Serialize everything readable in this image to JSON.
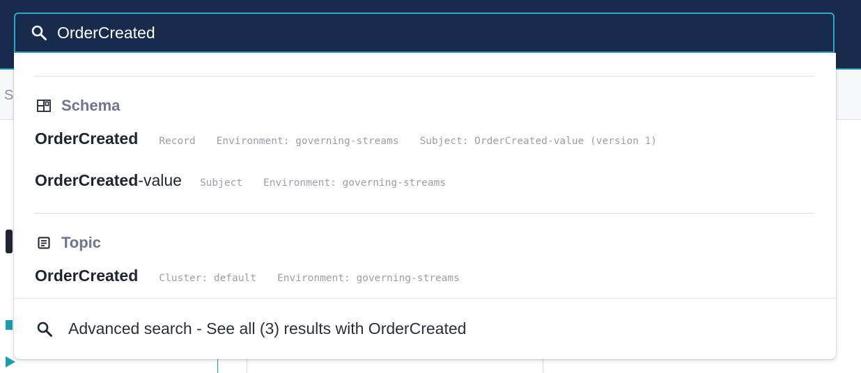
{
  "background": {
    "subnav_fragment": "S"
  },
  "search": {
    "value": "OrderCreated",
    "placeholder": ""
  },
  "sections": [
    {
      "title": "Schema",
      "icon": "schema-grid-icon",
      "results": [
        {
          "bold": "OrderCreated",
          "rest": "",
          "meta": [
            "Record",
            "Environment: governing-streams",
            "Subject: OrderCreated-value (version 1)"
          ]
        },
        {
          "bold": "OrderCreated",
          "rest": "-value",
          "meta": [
            "Subject",
            "Environment: governing-streams"
          ]
        }
      ]
    },
    {
      "title": "Topic",
      "icon": "topic-document-icon",
      "results": [
        {
          "bold": "OrderCreated",
          "rest": "",
          "meta": [
            "Cluster: default",
            "Environment: governing-streams"
          ]
        }
      ]
    }
  ],
  "footer": {
    "label": "Advanced search - See all (3) results with OrderCreated",
    "icon": "search-icon"
  },
  "colors": {
    "header_bg": "#172b4d",
    "accent": "#37a6c4",
    "section_title": "#6e7491",
    "meta_text": "#9a9eab"
  }
}
